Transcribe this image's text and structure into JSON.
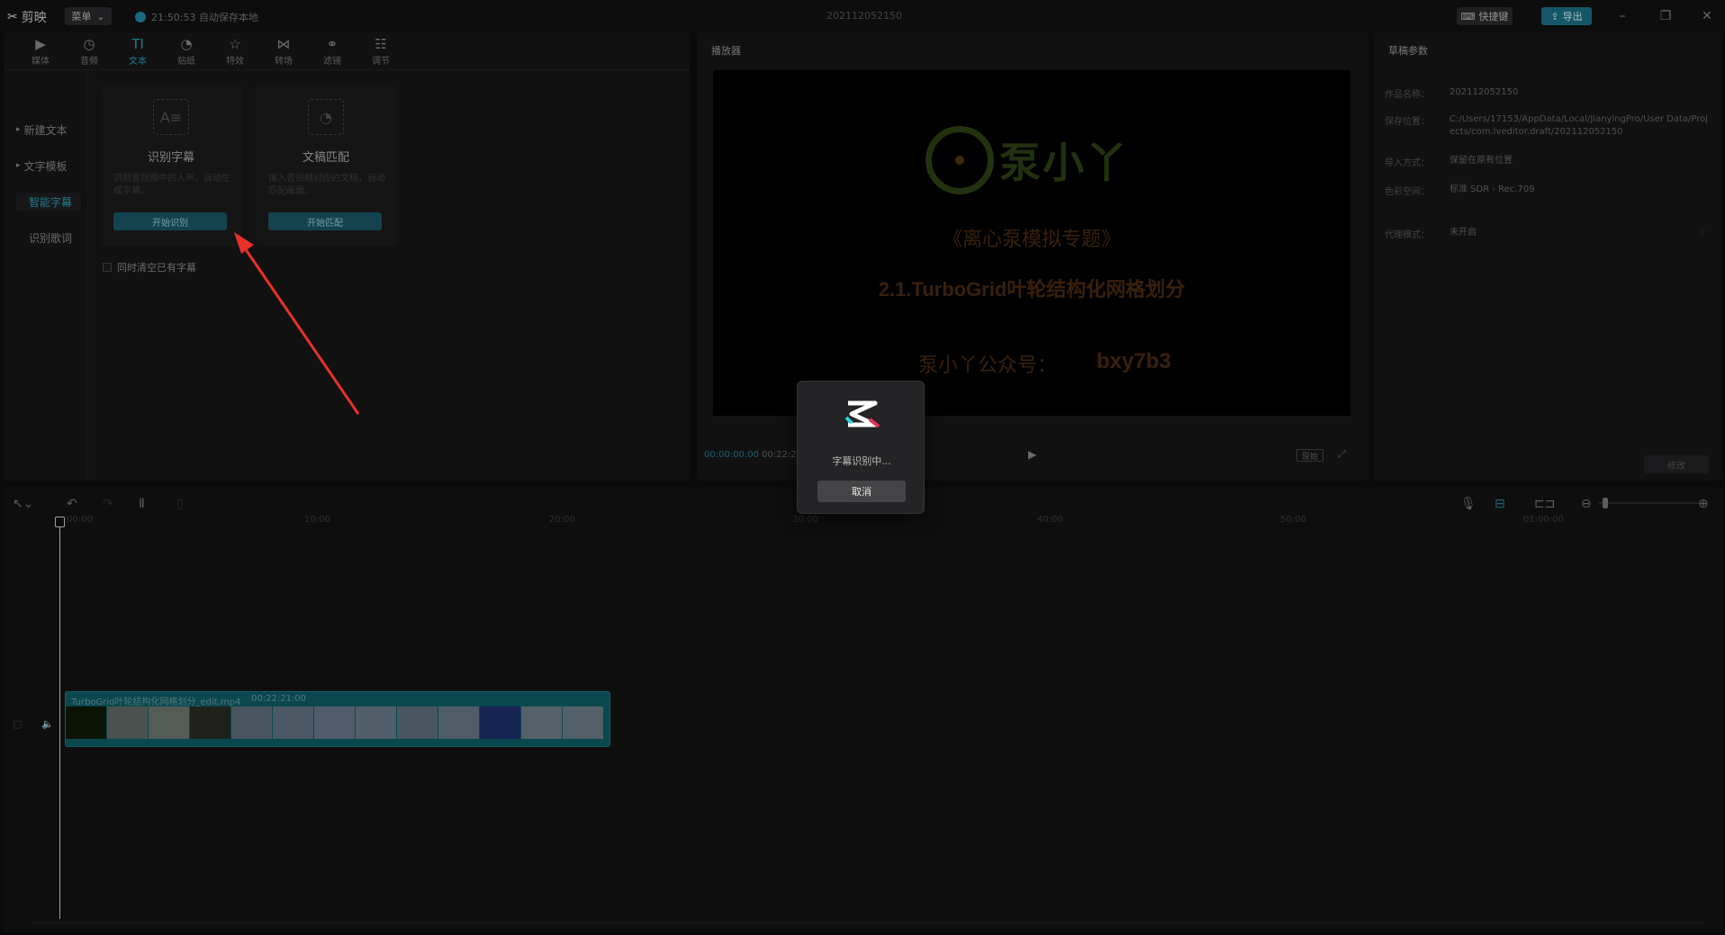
{
  "app": {
    "name": "剪映",
    "menu_label": "菜单",
    "autosave_text": "21:50:53 自动保存本地",
    "project_title": "202112052150",
    "shortcut_label": "快捷键",
    "export_label": "导出"
  },
  "tabs": [
    {
      "label": "媒体",
      "icon": "media-icon",
      "glyph": "▶"
    },
    {
      "label": "音频",
      "icon": "audio-icon",
      "glyph": "◷"
    },
    {
      "label": "文本",
      "icon": "text-icon",
      "glyph": "TI"
    },
    {
      "label": "贴纸",
      "icon": "sticker-icon",
      "glyph": "◔"
    },
    {
      "label": "特效",
      "icon": "effects-icon",
      "glyph": "☆"
    },
    {
      "label": "转场",
      "icon": "transition-icon",
      "glyph": "⋈"
    },
    {
      "label": "滤镜",
      "icon": "filter-icon",
      "glyph": "⚭"
    },
    {
      "label": "调节",
      "icon": "adjust-icon",
      "glyph": "☷"
    }
  ],
  "sidebar": {
    "items": [
      {
        "label": "新建文本",
        "arrow": "▸"
      },
      {
        "label": "文字模板",
        "arrow": "▸"
      },
      {
        "label": "智能字幕",
        "arrow": ""
      },
      {
        "label": "识别歌词",
        "arrow": ""
      }
    ]
  },
  "cards": {
    "recognize": {
      "title": "识别字幕",
      "desc": "识别音视频中的人声，自动生成字幕。",
      "action": "开始识别"
    },
    "match": {
      "title": "文稿匹配",
      "desc": "输入音视频对应的文稿，自动匹配画面。",
      "action": "开始匹配"
    },
    "clear_existing": "同时清空已有字幕"
  },
  "player": {
    "title": "播放器",
    "video_brand": "泵小丫",
    "video_line1": "《离心泵模拟专题》",
    "video_line2": "2.1.TurboGrid叶轮结构化网格划分",
    "video_line3a": "泵小丫公众号：",
    "video_line3b": "bxy7b3",
    "time_current": "00:00:00:00",
    "time_total": "00:22:2",
    "ratio_label": "原始"
  },
  "draft": {
    "title": "草稿参数",
    "rows": [
      {
        "label": "作品名称：",
        "value": "202112052150"
      },
      {
        "label": "保存位置：",
        "value": "C:/Users/17153/AppData/Local/JianyingPro/User Data/Projects/com.lveditor.draft/202112052150"
      },
      {
        "label": "导入方式：",
        "value": "保留在原有位置"
      },
      {
        "label": "色彩空间：",
        "value": "标准 SDR - Rec.709"
      },
      {
        "label": "代理模式：",
        "value": "未开启"
      }
    ],
    "modify_label": "修改"
  },
  "timeline": {
    "ruler": [
      "00:00",
      "10:00",
      "20:00",
      "30:00",
      "40:00",
      "50:00",
      "01:00:00"
    ],
    "clip_name": "TurboGrid叶轮结构化网格划分_edit.mp4",
    "clip_duration": "00:22:21:00"
  },
  "dialog": {
    "message": "字幕识别中...",
    "cancel_label": "取消"
  },
  "colors": {
    "accent": "#1f8aa3",
    "clip": "#0d5b64",
    "annotation_arrow": "#e8312a"
  }
}
